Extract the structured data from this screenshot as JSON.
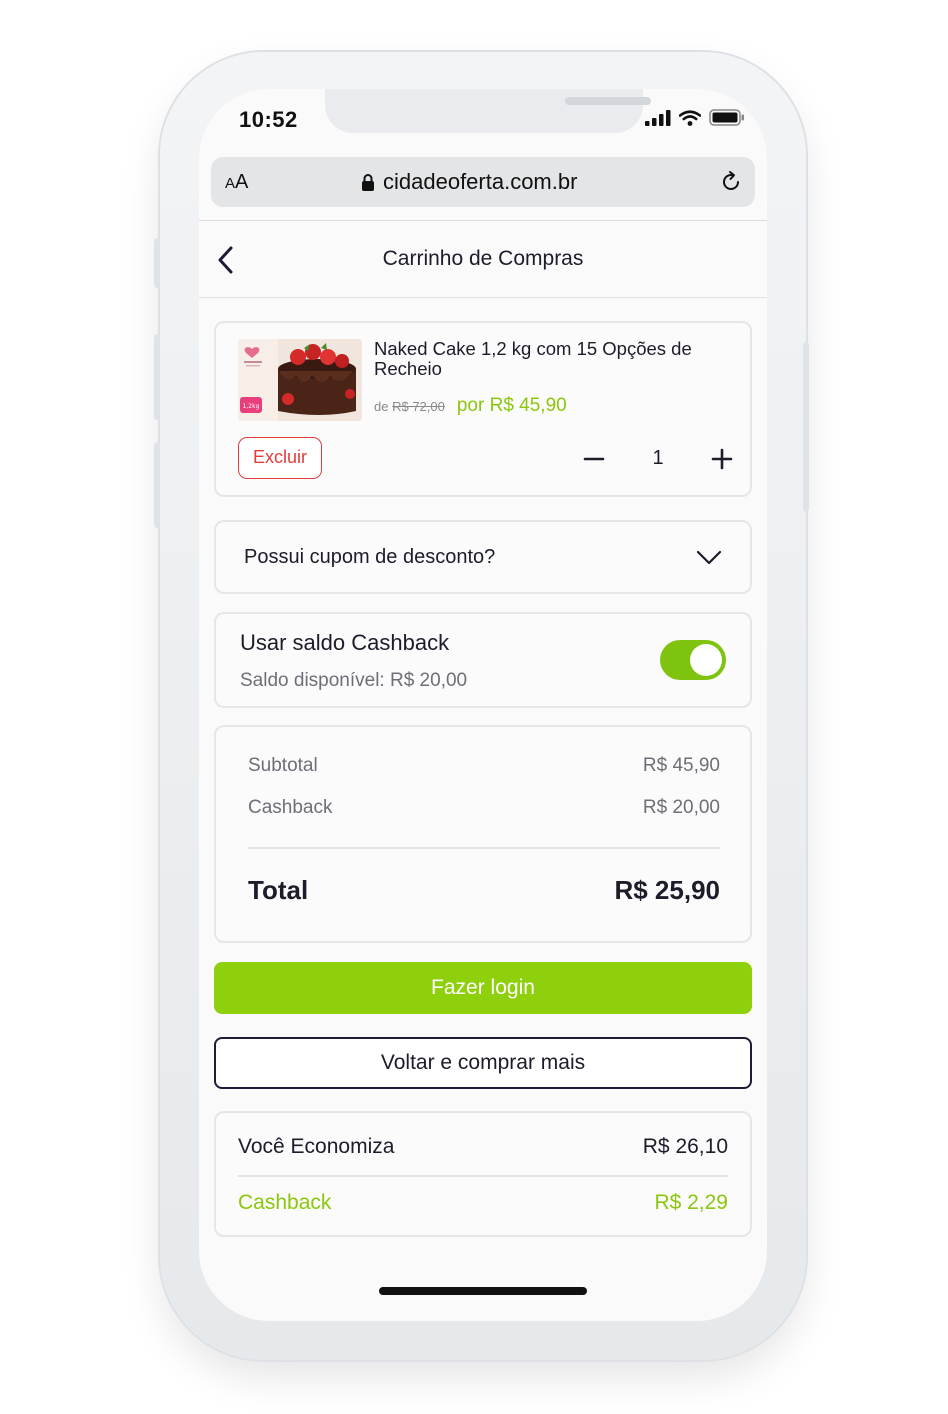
{
  "status_bar": {
    "time": "10:52",
    "icons": [
      "signal-icon",
      "wifi-icon",
      "battery-icon"
    ]
  },
  "browser": {
    "text_size_label": "AA",
    "url": "cidadeoferta.com.br",
    "icons": [
      "lock-icon",
      "reload-icon"
    ]
  },
  "header": {
    "title": "Carrinho de Compras",
    "back_icon": "chevron-left-icon"
  },
  "cart_item": {
    "name": "Naked Cake 1,2 kg com 15 Opções de Recheio",
    "old_price_prefix": "de",
    "old_price": "R$ 72,00",
    "new_price": "por R$ 45,90",
    "delete_label": "Excluir",
    "quantity": "1",
    "image_badge": "1,2kg"
  },
  "coupon": {
    "label": "Possui cupom de desconto?",
    "icon": "chevron-down-icon"
  },
  "cashback": {
    "title": "Usar saldo Cashback",
    "balance": "Saldo disponível: R$ 20,00",
    "enabled": true
  },
  "summary": {
    "subtotal_label": "Subtotal",
    "subtotal_value": "R$ 45,90",
    "cashback_label": "Cashback",
    "cashback_value": "R$ 20,00",
    "total_label": "Total",
    "total_value": "R$ 25,90"
  },
  "actions": {
    "login_label": "Fazer login",
    "continue_label": "Voltar e comprar mais"
  },
  "savings": {
    "label": "Você Economiza",
    "value": "R$ 26,10",
    "cashback_label": "Cashback",
    "cashback_value": "R$ 2,29"
  },
  "colors": {
    "accent_green": "#8fd00c",
    "danger_red": "#e23b3b",
    "dark_navy": "#1c1c3a"
  }
}
